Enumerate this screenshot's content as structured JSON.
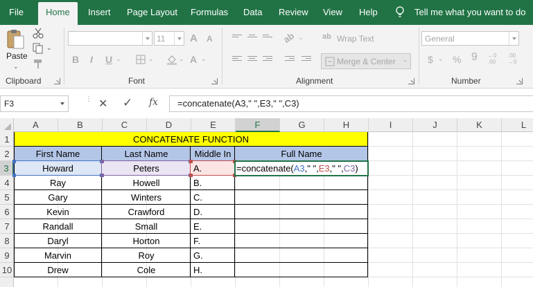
{
  "ribbon_tabs": [
    "File",
    "Home",
    "Insert",
    "Page Layout",
    "Formulas",
    "Data",
    "Review",
    "View",
    "Help"
  ],
  "active_tab": "Home",
  "tell_me": "Tell me what you want to do",
  "clipboard": {
    "paste_label": "Paste",
    "group_label": "Clipboard"
  },
  "font": {
    "font_name": "",
    "font_size": "11",
    "grow": "A",
    "shrink": "A",
    "bold": "B",
    "italic": "I",
    "underline": "U",
    "group_label": "Font"
  },
  "alignment": {
    "wrap_text": "Wrap Text",
    "merge_center": "Merge & Center",
    "group_label": "Alignment"
  },
  "number": {
    "format": "General",
    "currency": "$",
    "percent": "%",
    "comma": "9",
    "inc_decimal": "←0 .00",
    "dec_decimal": ".00 →0",
    "group_label": "Number"
  },
  "formula_bar": {
    "name_box": "F3",
    "cancel": "✕",
    "enter": "✓",
    "fx": "fx",
    "formula": "=concatenate(A3,\" \",E3,\" \",C3)"
  },
  "columns": [
    "A",
    "B",
    "C",
    "D",
    "E",
    "F",
    "G",
    "H",
    "I",
    "J",
    "K",
    "L"
  ],
  "rows": [
    "1",
    "2",
    "3",
    "4",
    "5",
    "6",
    "7",
    "8",
    "9",
    "10"
  ],
  "sheet": {
    "title": "CONCATENATE FUNCTION",
    "headers": {
      "first": "First Name",
      "last": "Last Name",
      "middle": "Middle In",
      "full": "Full Name"
    },
    "data": [
      {
        "first": "Howard",
        "last": "Peters",
        "middle": "A."
      },
      {
        "first": "Ray",
        "last": "Howell",
        "middle": "B."
      },
      {
        "first": "Gary",
        "last": "Winters",
        "middle": "C."
      },
      {
        "first": "Kevin",
        "last": "Crawford",
        "middle": "D."
      },
      {
        "first": "Randall",
        "last": "Small",
        "middle": "E."
      },
      {
        "first": "Daryl",
        "last": "Horton",
        "middle": "F."
      },
      {
        "first": "Marvin",
        "last": "Roy",
        "middle": "G."
      },
      {
        "first": "Drew",
        "last": "Cole",
        "middle": "H."
      }
    ],
    "edit_formula": {
      "prefix": "=concatenate(",
      "ref1": "A3",
      "sep1": ",\" \",",
      "ref2": "E3",
      "sep2": ",\" \",",
      "ref3": "C3",
      "suffix": ")"
    }
  },
  "colors": {
    "ribbon_green": "#217346",
    "title_fill": "#ffff00",
    "header_fill": "#b4c6e7",
    "ref_a3": "#4472c4",
    "ref_e3": "#c0504d",
    "ref_c3": "#8064a2"
  }
}
